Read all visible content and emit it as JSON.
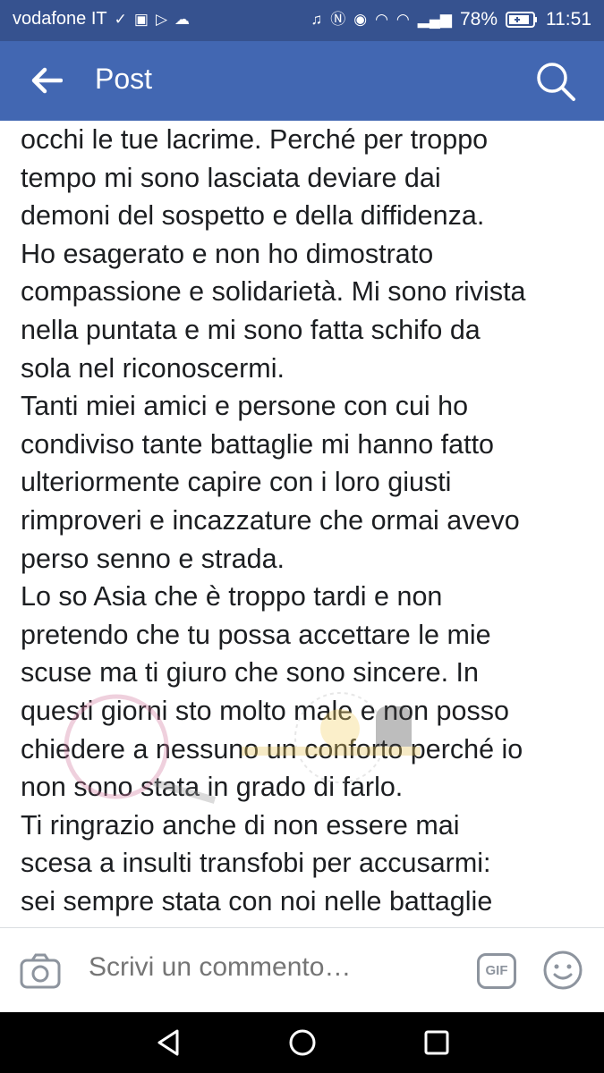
{
  "status_bar": {
    "carrier": "vodafone IT",
    "battery": "78%",
    "time": "11:51"
  },
  "header": {
    "title": "Post",
    "back_icon": "arrow-left-icon",
    "search_icon": "search-icon"
  },
  "post": {
    "text": "occhi le tue lacrime. Perché per troppo\ntempo mi sono lasciata deviare dai\ndemoni del sospetto e della diffidenza.\nHo esagerato e non ho dimostrato\ncompassione e solidarietà. Mi sono rivista\nnella puntata e mi sono fatta schifo da\nsola nel riconoscermi.\nTanti miei amici e persone con cui ho\ncondiviso tante battaglie mi hanno fatto\nulteriormente capire con i loro giusti\nrimproveri e incazzature che ormai avevo\nperso senno e strada.\nLo so Asia che è troppo tardi e non\npretendo che tu possa accettare le mie\nscuse ma ti giuro che sono sincere. In\nquesti giorni sto molto male e non posso\nchiedere a nessuno un conforto perché io\nnon sono stata in grado di farlo.\nTi ringrazio anche di non essere mai\nscesa a insulti transfobi per accusarmi:\nsei sempre stata con noi nelle battaglie\nLgbt e credo anche io che saresti una"
  },
  "composer": {
    "placeholder": "Scrivi un commento…",
    "gif_label": "GIF",
    "camera_icon": "camera-icon",
    "emoji_icon": "smiley-icon"
  },
  "nav": {
    "back": "triangle-back-icon",
    "home": "circle-home-icon",
    "recents": "square-recents-icon"
  },
  "colors": {
    "status_bar": "#36528f",
    "app_bar": "#4267b2",
    "text": "#1c1e21",
    "placeholder": "#8d949e"
  }
}
